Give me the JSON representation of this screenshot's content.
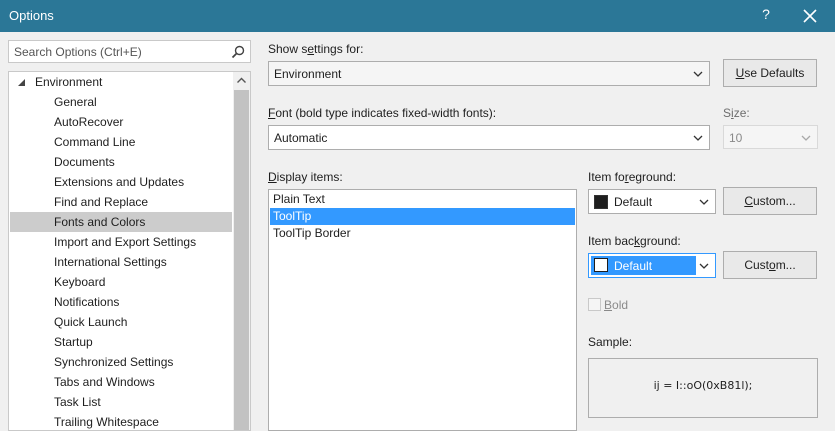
{
  "window": {
    "title": "Options",
    "help_glyph": "?"
  },
  "search": {
    "placeholder": "Search Options (Ctrl+E)"
  },
  "tree": {
    "root": "Environment",
    "items": [
      "General",
      "AutoRecover",
      "Command Line",
      "Documents",
      "Extensions and Updates",
      "Find and Replace",
      "Fonts and Colors",
      "Import and Export Settings",
      "International Settings",
      "Keyboard",
      "Notifications",
      "Quick Launch",
      "Startup",
      "Synchronized Settings",
      "Tabs and Windows",
      "Task List",
      "Trailing Whitespace"
    ],
    "selected_index": 6
  },
  "settings": {
    "show_settings_pre": "Show s",
    "show_settings_u": "e",
    "show_settings_post": "ttings for:",
    "show_settings_value": "Environment",
    "use_defaults_u": "U",
    "use_defaults_post": "se Defaults",
    "font_u": "F",
    "font_post": "ont (bold type indicates fixed-width fonts):",
    "font_value": "Automatic",
    "size_pre": "S",
    "size_u": "i",
    "size_post": "ze:",
    "size_value": "10"
  },
  "display_items": {
    "label_u": "D",
    "label_post": "isplay items:",
    "items": [
      "Plain Text",
      "ToolTip",
      "ToolTip Border"
    ],
    "selected_index": 1
  },
  "foreground": {
    "label_pre": "Item fo",
    "label_u": "r",
    "label_post": "eground:",
    "value": "Default",
    "swatch_color": "#1e1e1e",
    "custom_u": "C",
    "custom_post": "ustom..."
  },
  "background": {
    "label_pre": "Item bac",
    "label_u": "k",
    "label_post": "ground:",
    "value": "Default",
    "swatch_color": "#ffffff",
    "custom_pre": "Cust",
    "custom_u": "o",
    "custom_post": "m..."
  },
  "bold": {
    "u": "B",
    "post": "old",
    "checked": false
  },
  "sample": {
    "label_pre": "Sample",
    "label_post": ":",
    "text": "ij = I::oO(0xB81l);"
  },
  "colors": {
    "titlebar": "#2b7797",
    "selection": "#3399ff",
    "tree_selected": "#cccccc"
  }
}
